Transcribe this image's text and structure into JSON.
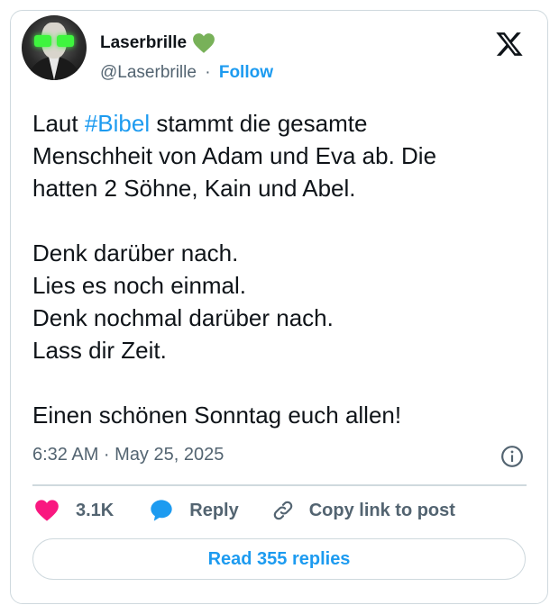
{
  "user": {
    "display_name": "Laserbrille",
    "handle": "@Laserbrille",
    "separator": "·",
    "follow_label": "Follow",
    "badge_icon": "green-heart-icon"
  },
  "tweet": {
    "lines_1": [
      "Laut ",
      "#Bibel",
      " stammt die gesamte"
    ],
    "line_2": "Menschheit von Adam und Eva ab. Die",
    "line_3": "hatten 2 Söhne, Kain und Abel.",
    "line_5": "Denk darüber nach.",
    "line_6": "Lies es noch einmal.",
    "line_7": "Denk nochmal darüber nach.",
    "line_8": "Lass dir Zeit.",
    "line_10": "Einen schönen Sonntag euch allen!"
  },
  "meta": {
    "timestamp": "6:32 AM · May 25, 2025"
  },
  "actions": {
    "likes_count": "3.1K",
    "reply_label": "Reply",
    "copy_label": "Copy link to post"
  },
  "read_replies_label": "Read 355 replies",
  "colors": {
    "accent": "#1d9bf0",
    "like": "#f91880",
    "secondary_text": "#536471",
    "border": "#cfd9de"
  }
}
